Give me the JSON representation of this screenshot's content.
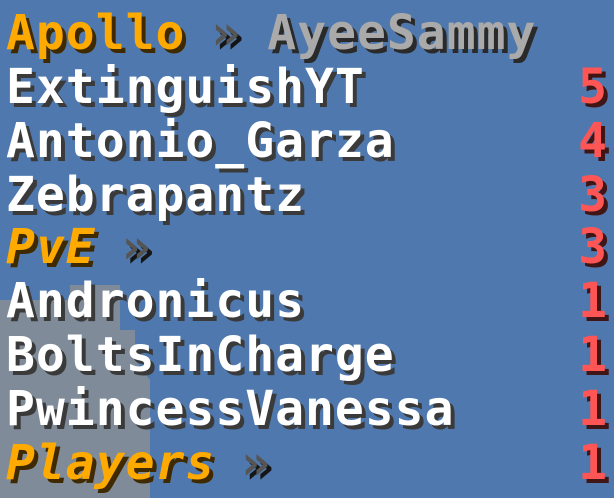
{
  "header": {
    "server": "Apollo",
    "separator": "»",
    "player": "AyeeSammy"
  },
  "entries": [
    {
      "name": "ExtinguishYT",
      "score": "5"
    },
    {
      "name": "Antonio_Garza",
      "score": "4"
    },
    {
      "name": "Zebrapantz",
      "score": "3"
    }
  ],
  "section": {
    "label": "PvE",
    "separator": "»",
    "score": "3"
  },
  "entries2": [
    {
      "name": "Andronicus",
      "score": "1"
    },
    {
      "name": "BoltsInCharge",
      "score": "1"
    },
    {
      "name": "PwincessVanessa",
      "score": "1"
    }
  ],
  "footer": {
    "label": "Players",
    "separator": "»",
    "score": "1"
  },
  "colors": {
    "background": "#4f79ae",
    "gold": "#ffaa00",
    "score_red": "#ff5555",
    "white": "#ffffff",
    "grey": "#aaaaaa"
  }
}
